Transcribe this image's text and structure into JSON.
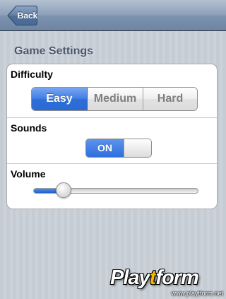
{
  "nav": {
    "back_label": "Back"
  },
  "section_title": "Game Settings",
  "difficulty": {
    "label": "Difficulty",
    "options": [
      "Easy",
      "Medium",
      "Hard"
    ],
    "selected": "Easy"
  },
  "sounds": {
    "label": "Sounds",
    "state_label": "ON",
    "on": true
  },
  "volume": {
    "label": "Volume",
    "level": 0.15
  },
  "watermark": {
    "logo_prefix": "Play",
    "logo_accent": "t",
    "logo_suffix": "form",
    "url": "www.playtform.net"
  },
  "colors": {
    "accent": "#2e6fdc",
    "navbar": "#6d84a2",
    "background": "#c5ccd4"
  },
  "icons": {
    "back": "back-arrow-button"
  }
}
